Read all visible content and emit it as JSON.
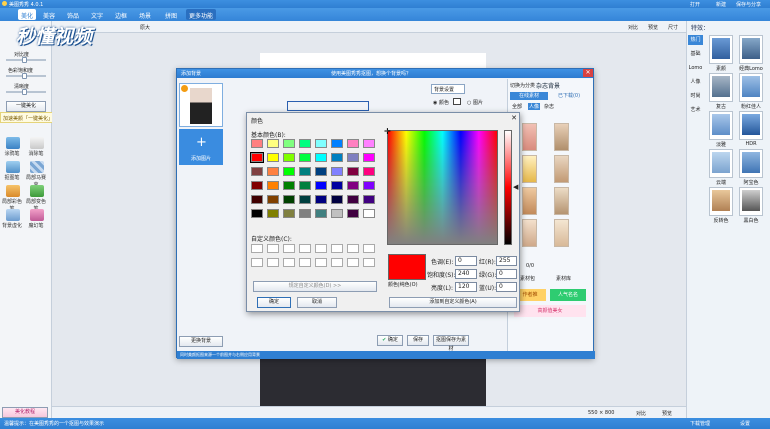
{
  "app": {
    "title": "美图秀秀 4.0.1"
  },
  "titlebar_right": [
    "打开",
    "新建",
    "保存与分享"
  ],
  "toolbar": {
    "tabs": [
      "美化",
      "美容",
      "饰品",
      "文字",
      "边框",
      "场景",
      "拼图",
      "更多功能"
    ],
    "active": "美化"
  },
  "subbar": {
    "left_label": "基础",
    "right_items": [
      "对比",
      "预览",
      "尺寸"
    ],
    "middle_label": "原大"
  },
  "left": {
    "sliders": [
      "对比度",
      "色彩饱和度",
      "清晰度"
    ],
    "one_click": "一键美化",
    "notice": "加速美颜「一键美化」超大的功能发现美人，快来试试吧！",
    "tools": [
      "涂鸦笔",
      "消除笔",
      "抠图笔",
      "局部马赛克",
      "局部彩色笔",
      "局部变色笔",
      "背景虚化",
      "魔幻笔"
    ],
    "bottom": "美化教程"
  },
  "right": {
    "header": "特效：",
    "cats": [
      "热门",
      "基础",
      "Lomo",
      "人像",
      "时尚",
      "艺术"
    ],
    "items": [
      "素颜",
      "经典Lomo",
      "复古",
      "粉红佳人",
      "淡雅",
      "HDR",
      "云端",
      "阿宝色",
      "反转色",
      "黑白色"
    ]
  },
  "dialog": {
    "title": "添加背景",
    "msg": "使用美图秀秀抠图，想换个背景吗？",
    "add_label": "添加图片",
    "change_bg": "更换背景",
    "bg_settings": "背景设置",
    "bg_opts": [
      "颜色",
      "图片"
    ],
    "confirm": "确定",
    "save": "保存",
    "save_as": "抠图保存为素材",
    "footer": "同时美颜抠图来源一个前图并与右侧应用背景",
    "side_tabs": [
      "在线素材",
      "已下载(0)"
    ],
    "side_title": "杂志背景",
    "cut_mode": "切换为分类",
    "cats": [
      "全部",
      "人像",
      "杂志"
    ],
    "pager": "0/0",
    "side_btns": [
      "下载素材包",
      "素材库"
    ],
    "tags": [
      "作者推",
      "人气名名",
      "高颜值美女"
    ]
  },
  "color": {
    "title": "颜色",
    "basic": "基本颜色(B):",
    "custom": "自定义颜色(C):",
    "define": "规定自定义颜色(D) >>",
    "ok": "确定",
    "cancel": "取消",
    "solid": "颜色|纯色(O)",
    "add": "添加到自定义颜色(A)",
    "hue_lbl": "色调(E):",
    "hue": "0",
    "sat_lbl": "饱和度(S):",
    "sat": "240",
    "lum_lbl": "亮度(L):",
    "lum": "120",
    "r_lbl": "红(R):",
    "r": "255",
    "g_lbl": "绿(G):",
    "g": "0",
    "b_lbl": "蓝(U):",
    "b": "0",
    "current_color": "#ff0000",
    "basic_colors": [
      "#ff8080",
      "#ffff80",
      "#80ff80",
      "#00ff80",
      "#80ffff",
      "#0080ff",
      "#ff80c0",
      "#ff80ff",
      "#ff0000",
      "#ffff00",
      "#80ff00",
      "#00ff40",
      "#00ffff",
      "#0080c0",
      "#8080c0",
      "#ff00ff",
      "#804040",
      "#ff8040",
      "#00ff00",
      "#008080",
      "#004080",
      "#8080ff",
      "#800040",
      "#ff0080",
      "#800000",
      "#ff8000",
      "#008000",
      "#008040",
      "#0000ff",
      "#0000a0",
      "#800080",
      "#8000ff",
      "#400000",
      "#804000",
      "#004000",
      "#004040",
      "#000080",
      "#000040",
      "#400040",
      "#400080",
      "#000000",
      "#808000",
      "#808040",
      "#808080",
      "#408080",
      "#c0c0c0",
      "#400040",
      "#ffffff"
    ]
  },
  "canvas": {
    "size": "550 × 800"
  },
  "bottom": {
    "items": [
      "对比",
      "预览"
    ]
  },
  "statusbar": {
    "left": "温馨提示：在美图秀秀的一个抠图与效果演示",
    "right": [
      "下载管理",
      "设置"
    ]
  },
  "logo": "秒懂视频"
}
